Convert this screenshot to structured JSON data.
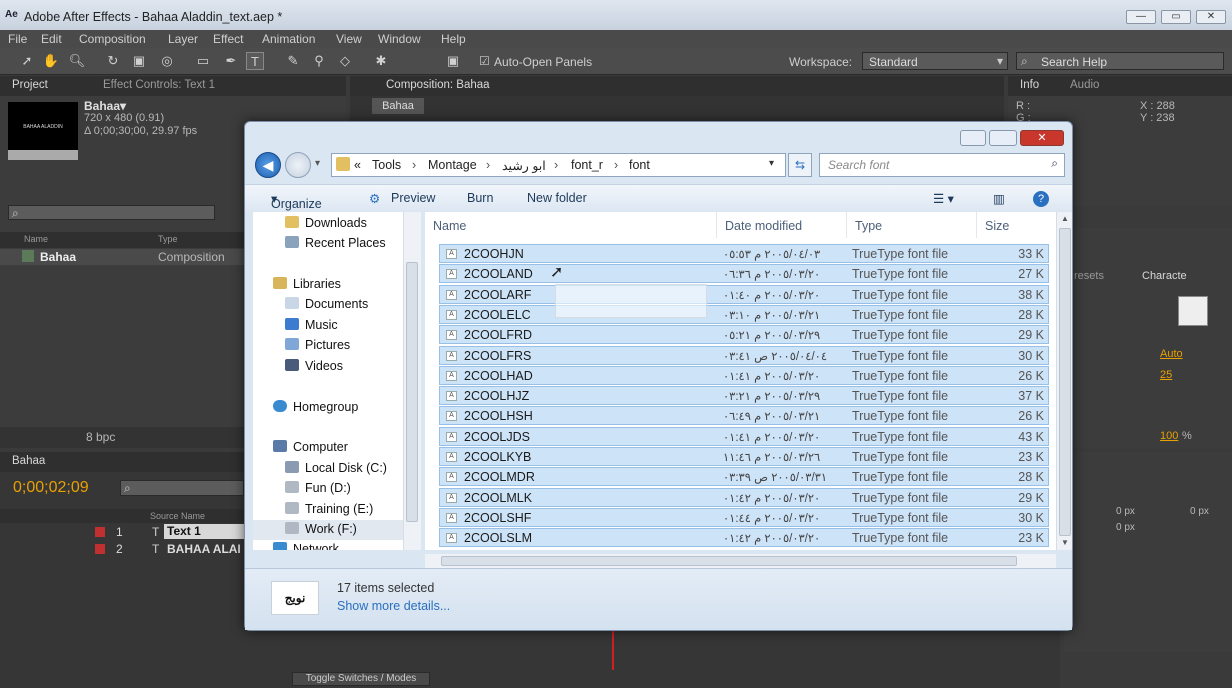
{
  "app": {
    "title": "Adobe After Effects - Bahaa Aladdin_text.aep *",
    "logo": "Ae",
    "menus": [
      "File",
      "Edit",
      "Composition",
      "Layer",
      "Effect",
      "Animation",
      "View",
      "Window",
      "Help"
    ],
    "auto_open_panels": "Auto-Open Panels",
    "workspace_label": "Workspace:",
    "workspace_value": "Standard",
    "search_help": "Search Help"
  },
  "project_panel": {
    "tab_project": "Project",
    "tab_effect_controls": "Effect Controls: Text 1",
    "comp_name": "Bahaa▾",
    "comp_thumb_text": "BAHAA ALADDIN",
    "comp_size": "720 x 480 (0.91)",
    "comp_duration": "Δ 0;00;30;00, 29.97 fps",
    "col_name": "Name",
    "col_type": "Type",
    "item_name": "Bahaa",
    "item_type": "Composition",
    "bpc": "8 bpc"
  },
  "composition_panel": {
    "tab": "Composition: Bahaa",
    "chip": "Bahaa"
  },
  "info_panel": {
    "tab_info": "Info",
    "tab_audio": "Audio",
    "r_label": "R :",
    "g_label": "G :",
    "x": "X : 288",
    "y": "Y : 238"
  },
  "right_panels": {
    "presets": "resets",
    "character": "Characte",
    "kern": "Auto",
    "track": "25",
    "scale": "100",
    "unit_percent": "%",
    "px1": "0 px",
    "px2": "0 px",
    "px3": "0 px",
    "px4": "0 px"
  },
  "timeline": {
    "tab": "Bahaa",
    "timecode": "0;00;02;09",
    "col_source": "Source Name",
    "layers": [
      {
        "num": "1",
        "name": "Text 1"
      },
      {
        "num": "2",
        "name": "BAHAA ALAI"
      }
    ],
    "toggle": "Toggle Switches / Modes"
  },
  "dialog": {
    "breadcrumbs": [
      "Tools",
      "Montage",
      "ابو رشيد",
      "font_r",
      "font"
    ],
    "crumb_prefix": "«",
    "search_placeholder": "Search font",
    "commands": {
      "organize": "Organize",
      "preview": "Preview",
      "burn": "Burn",
      "new_folder": "New folder"
    },
    "nav": {
      "downloads": "Downloads",
      "recent_places": "Recent Places",
      "libraries": "Libraries",
      "documents": "Documents",
      "music": "Music",
      "pictures": "Pictures",
      "videos": "Videos",
      "homegroup": "Homegroup",
      "computer": "Computer",
      "local_disk": "Local Disk (C:)",
      "fun": "Fun (D:)",
      "training": "Training (E:)",
      "work": "Work (F:)",
      "network": "Network"
    },
    "columns": {
      "name": "Name",
      "date": "Date modified",
      "type": "Type",
      "size": "Size"
    },
    "files": [
      {
        "name": "2COOHJN",
        "date": "٢٠٠٥/٠٤/٠٣ م ٠٥:٥٣",
        "type": "TrueType font file",
        "size": "33 K"
      },
      {
        "name": "2COOLAND",
        "date": "٢٠٠٥/٠٣/٢٠ م ٠٦:٣٦",
        "type": "TrueType font file",
        "size": "27 K"
      },
      {
        "name": "2COOLARF",
        "date": "٢٠٠٥/٠٣/٢٠ م ٠١:٤٠",
        "type": "TrueType font file",
        "size": "38 K"
      },
      {
        "name": "2COOLELC",
        "date": "٢٠٠٥/٠٣/٢١ م ٠٣:١٠",
        "type": "TrueType font file",
        "size": "28 K"
      },
      {
        "name": "2COOLFRD",
        "date": "٢٠٠٥/٠٣/٢٩ م ٠٥:٢١",
        "type": "TrueType font file",
        "size": "29 K"
      },
      {
        "name": "2COOLFRS",
        "date": "٢٠٠٥/٠٤/٠٤ ص ٠٣:٤١",
        "type": "TrueType font file",
        "size": "30 K"
      },
      {
        "name": "2COOLHAD",
        "date": "٢٠٠٥/٠٣/٢٠ م ٠١:٤١",
        "type": "TrueType font file",
        "size": "26 K"
      },
      {
        "name": "2COOLHJZ",
        "date": "٢٠٠٥/٠٣/٢٩ م ٠٣:٢١",
        "type": "TrueType font file",
        "size": "37 K"
      },
      {
        "name": "2COOLHSH",
        "date": "٢٠٠٥/٠٣/٢١ م ٠٦:٤٩",
        "type": "TrueType font file",
        "size": "26 K"
      },
      {
        "name": "2COOLJDS",
        "date": "٢٠٠٥/٠٣/٢٠ م ٠١:٤١",
        "type": "TrueType font file",
        "size": "43 K"
      },
      {
        "name": "2COOLKYB",
        "date": "٢٠٠٥/٠٣/٢٦ م ١١:٤٦",
        "type": "TrueType font file",
        "size": "23 K"
      },
      {
        "name": "2COOLMDR",
        "date": "٢٠٠٥/٠٣/٣١ ص ٠٣:٣٩",
        "type": "TrueType font file",
        "size": "28 K"
      },
      {
        "name": "2COOLMLK",
        "date": "٢٠٠٥/٠٣/٢٠ م ٠١:٤٢",
        "type": "TrueType font file",
        "size": "29 K"
      },
      {
        "name": "2COOLSHF",
        "date": "٢٠٠٥/٠٣/٢٠ م ٠١:٤٤",
        "type": "TrueType font file",
        "size": "30 K"
      },
      {
        "name": "2COOLSLM",
        "date": "٢٠٠٥/٠٣/٢٠ م ٠١:٤٢",
        "type": "TrueType font file",
        "size": "23 K"
      }
    ],
    "selected_count": "17 items selected",
    "show_more": "Show more details...",
    "thumb_text": "نويج"
  },
  "colors": {
    "accent_timecode": "#e8a100",
    "selection": "#cde3f8",
    "close_red": "#c9372c"
  }
}
